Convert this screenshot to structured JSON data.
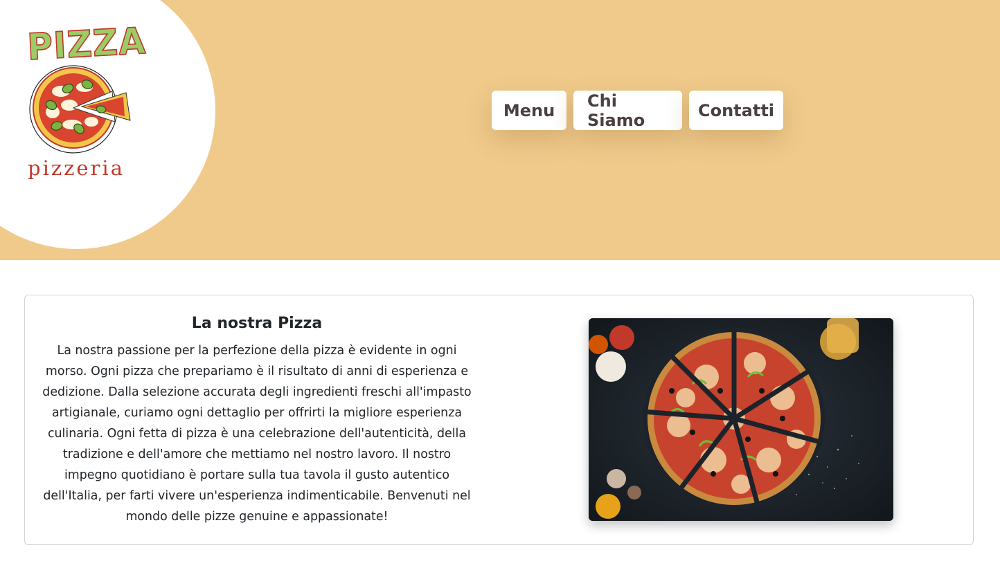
{
  "logo": {
    "word_top": "PIZZA",
    "word_bottom": "pizzeria"
  },
  "nav": {
    "items": [
      {
        "label": "Menu"
      },
      {
        "label": "Chi Siamo"
      },
      {
        "label": "Contatti"
      }
    ]
  },
  "about": {
    "title": "La nostra Pizza",
    "body": "La nostra passione per la perfezione della pizza è evidente in ogni morso. Ogni pizza che prepariamo è il risultato di anni di esperienza e dedizione. Dalla selezione accurata degli ingredienti freschi all'impasto artigianale, curiamo ogni dettaglio per offrirti la migliore esperienza culinaria. Ogni fetta di pizza è una celebrazione dell'autenticità, della tradizione e dell'amore che mettiamo nel nostro lavoro. Il nostro impegno quotidiano è portare sulla tua tavola il gusto autentico dell'Italia, per farti vivere un'esperienza indimenticabile. Benvenuti nel mondo delle pizze genuine e appassionate!"
  },
  "colors": {
    "header_bg": "#f0ca8b",
    "nav_text": "#4a4040",
    "logo_red": "#c0392b",
    "logo_green": "#9ccc65"
  }
}
